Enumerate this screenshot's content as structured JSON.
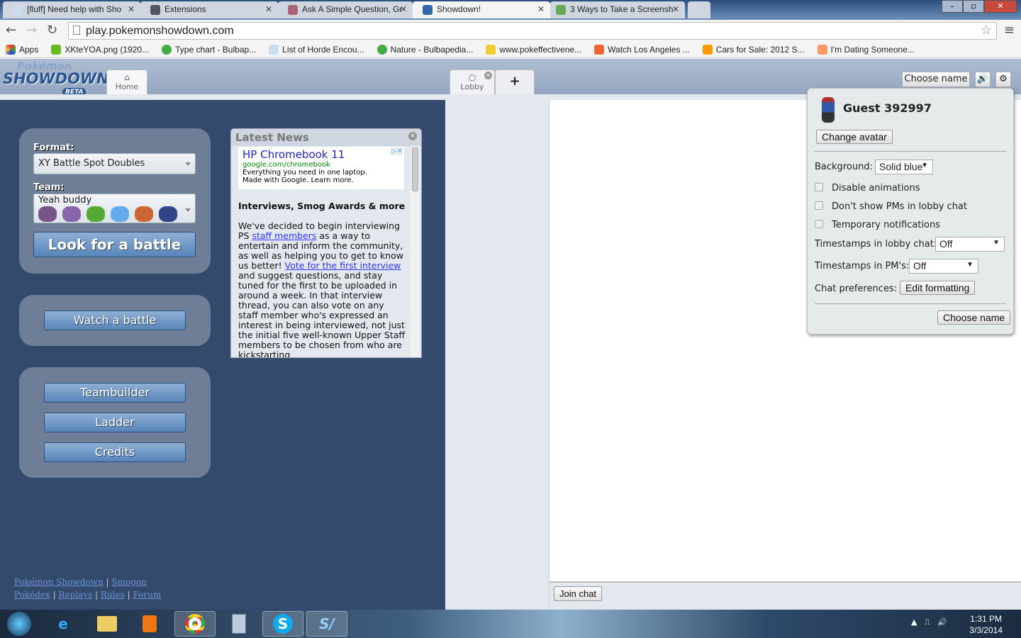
{
  "browser": {
    "tabs": [
      {
        "label": "[fluff] Need help with Sho"
      },
      {
        "label": "Extensions"
      },
      {
        "label": "Ask A Simple Question, Gr"
      },
      {
        "label": "Showdown!"
      },
      {
        "label": "3 Ways to Take a Screensh"
      }
    ],
    "url": "play.pokemonshowdown.com",
    "bookmarks": [
      {
        "label": "Apps"
      },
      {
        "label": "XKteYOA.png (1920..."
      },
      {
        "label": "Type chart - Bulbap..."
      },
      {
        "label": "List of Horde Encou..."
      },
      {
        "label": "Nature - Bulbapedia..."
      },
      {
        "label": "www.pokeffectivene..."
      },
      {
        "label": "Watch Los Angeles ..."
      },
      {
        "label": "Cars for Sale: 2012 S..."
      },
      {
        "label": "I'm Dating Someone..."
      }
    ]
  },
  "header": {
    "logo": {
      "line1": "Pokémon",
      "line2": "SHOWDOWN",
      "badge": "BETA"
    },
    "home_tab": "Home",
    "lobby_tab": "Lobby",
    "add_tab": "+",
    "choose_name": "Choose name"
  },
  "battle": {
    "format_label": "Format:",
    "format_value": "XY Battle Spot Doubles",
    "team_label": "Team:",
    "team_value": "Yeah buddy",
    "look_button": "Look for a battle"
  },
  "menu": {
    "watch": "Watch a battle",
    "teambuilder": "Teambuilder",
    "ladder": "Ladder",
    "credits": "Credits"
  },
  "news": {
    "title": "Latest News",
    "ad": {
      "title": "HP Chromebook 11",
      "url": "google.com/chromebook",
      "line1": "Everything you need in one laptop.",
      "line2": "Made with Google. Learn more."
    },
    "headline": "Interviews, Smog Awards & more",
    "p1": "We've decided to begin interviewing PS ",
    "link1": "staff members",
    "p2": " as a way to entertain and inform the community, as well as helping you to get to know us better! ",
    "link2": "Vote for the first interview",
    "p3": " and suggest questions, and stay tuned for the first to be uploaded in around a week. In that interview thread, you can also vote on any staff member who's expressed an interest in being interviewed, not just the initial five well-known Upper Staff members to be chosen from who are kickstarting"
  },
  "footer": {
    "links": [
      "Pokémon Showdown",
      "Smogon",
      "Pokédex",
      "Replays",
      "Rules",
      "Forum"
    ],
    "sep": "|"
  },
  "chat": {
    "join_button": "Join chat"
  },
  "settings": {
    "username": "Guest 392997",
    "change_avatar": "Change avatar",
    "background_label": "Background:",
    "background_value": "Solid blue",
    "checkboxes": [
      {
        "label": "Disable animations",
        "checked": false
      },
      {
        "label": "Don't show PMs in lobby chat",
        "checked": false
      },
      {
        "label": "Temporary notifications",
        "checked": false
      }
    ],
    "ts_lobby_label": "Timestamps in lobby chat:",
    "ts_lobby_value": "Off",
    "ts_pm_label": "Timestamps in PM's:",
    "ts_pm_value": "Off",
    "chat_prefs_label": "Chat preferences:",
    "edit_formatting": "Edit formatting",
    "choose_name": "Choose name"
  },
  "taskbar": {
    "time": "1:31 PM",
    "date": "3/3/2014"
  }
}
